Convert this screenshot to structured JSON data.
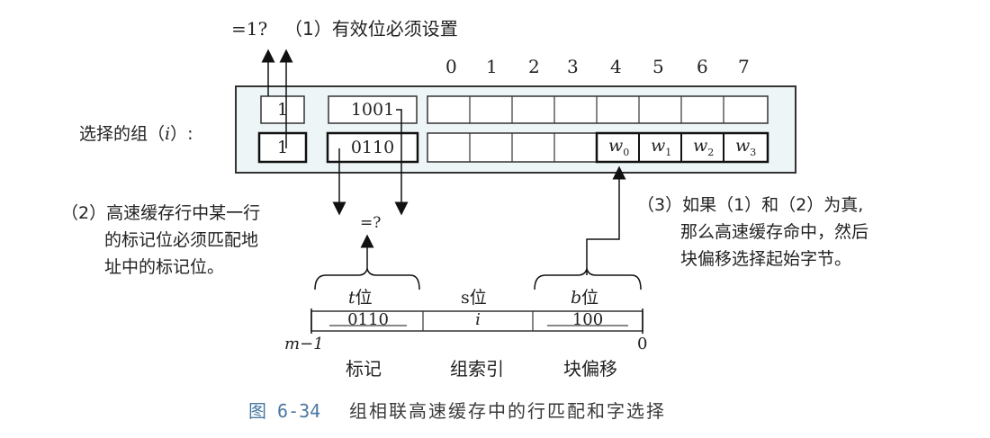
{
  "top_check": {
    "eq_label": "=1?",
    "note": "（1）有效位必须设置"
  },
  "word_offsets": [
    "0",
    "1",
    "2",
    "3",
    "4",
    "5",
    "6",
    "7"
  ],
  "selected_set": {
    "label": "选择的组（",
    "label_i": "i",
    "label_end": "）:"
  },
  "lines": [
    {
      "valid": "1",
      "tag": "1001",
      "words": [
        "",
        "",
        "",
        "",
        "",
        "",
        "",
        ""
      ]
    },
    {
      "valid": "1",
      "tag": "0110",
      "words": [
        "",
        "",
        "",
        "",
        "w",
        "w",
        "w",
        "w"
      ],
      "word_subs": [
        "",
        "",
        "",
        "",
        "0",
        "1",
        "2",
        "3"
      ]
    }
  ],
  "note2": [
    "（2）高速缓存行中某一行",
    "的标记位必须匹配地",
    "址中的标记位。"
  ],
  "tag_compare": "=?",
  "note3": [
    "（3）如果（1）和（2）为真,",
    "那么高速缓存命中，然后",
    "块偏移选择起始字节。"
  ],
  "address": {
    "fields": [
      {
        "head_var": "t",
        "head_unit": "位",
        "value": "0110",
        "name": "标记"
      },
      {
        "head_var": "s",
        "head_unit": "位",
        "value": "i",
        "name": "组索引"
      },
      {
        "head_var": "b",
        "head_unit": "位",
        "value": "100",
        "name": "块偏移"
      }
    ],
    "high_bit": "m−1",
    "low_bit": "0"
  },
  "caption": {
    "figure_no": "图 6-34",
    "title": "组相联高速缓存中的行匹配和字选择"
  }
}
